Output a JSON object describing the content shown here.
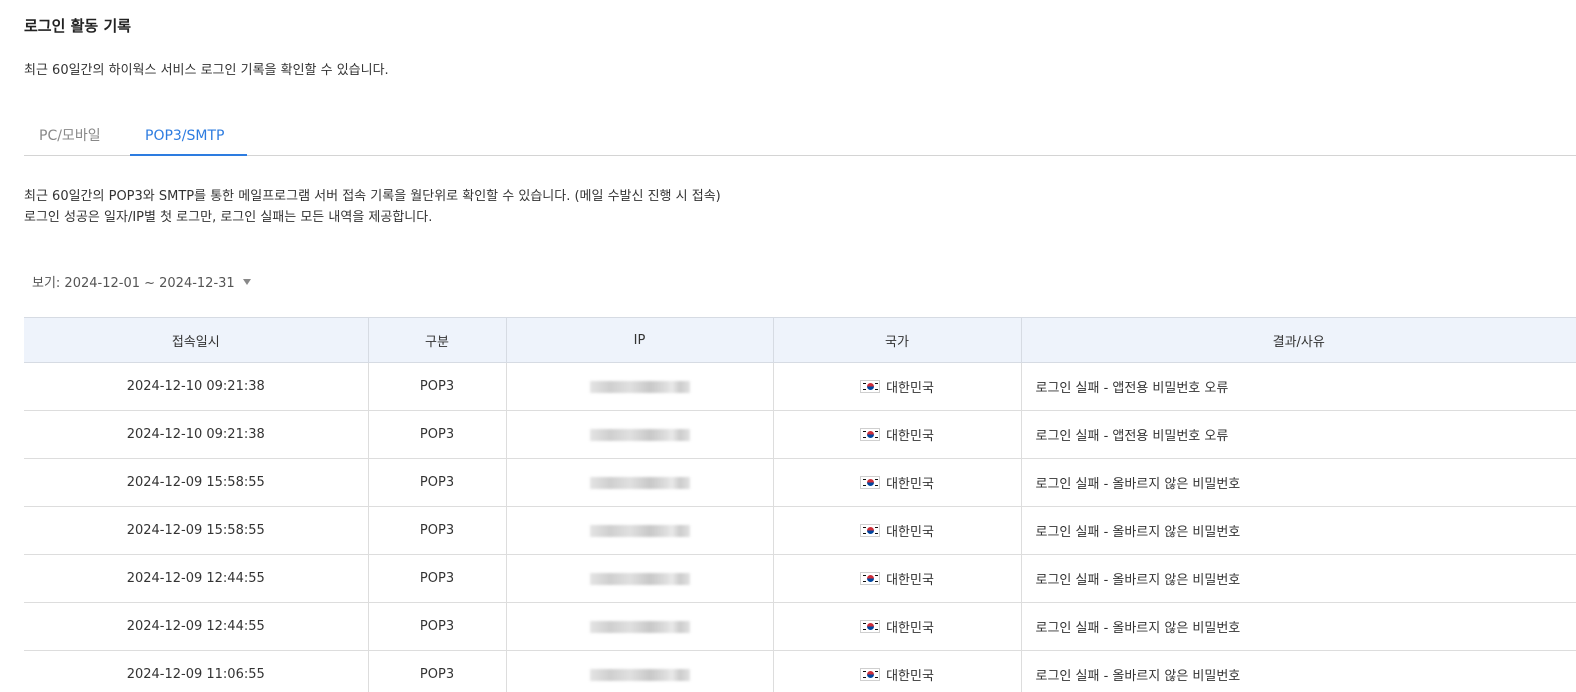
{
  "page": {
    "title": "로그인 활동 기록",
    "description": "최근 60일간의 하이웍스 서비스 로그인 기록을 확인할 수 있습니다."
  },
  "tabs": [
    {
      "label": "PC/모바일",
      "active": false
    },
    {
      "label": "POP3/SMTP",
      "active": true
    }
  ],
  "notice": {
    "line1": "최근 60일간의 POP3와 SMTP를 통한 메일프로그램 서버 접속 기록을 월단위로 확인할 수 있습니다. (메일 수발신 진행 시 접속)",
    "line2": "로그인 성공은 일자/IP별 첫 로그만, 로그인 실패는 모든 내역을 제공합니다."
  },
  "filter": {
    "label": "보기: 2024-12-01 ~ 2024-12-31"
  },
  "table": {
    "headers": {
      "datetime": "접속일시",
      "type": "구분",
      "ip": "IP",
      "country": "국가",
      "result": "결과/사유"
    },
    "rows": [
      {
        "datetime": "2024-12-10 09:21:38",
        "type": "POP3",
        "country": "대한민국",
        "result": "로그인 실패 - 앱전용 비밀번호 오류"
      },
      {
        "datetime": "2024-12-10 09:21:38",
        "type": "POP3",
        "country": "대한민국",
        "result": "로그인 실패 - 앱전용 비밀번호 오류"
      },
      {
        "datetime": "2024-12-09 15:58:55",
        "type": "POP3",
        "country": "대한민국",
        "result": "로그인 실패 - 올바르지 않은 비밀번호"
      },
      {
        "datetime": "2024-12-09 15:58:55",
        "type": "POP3",
        "country": "대한민국",
        "result": "로그인 실패 - 올바르지 않은 비밀번호"
      },
      {
        "datetime": "2024-12-09 12:44:55",
        "type": "POP3",
        "country": "대한민국",
        "result": "로그인 실패 - 올바르지 않은 비밀번호"
      },
      {
        "datetime": "2024-12-09 12:44:55",
        "type": "POP3",
        "country": "대한민국",
        "result": "로그인 실패 - 올바르지 않은 비밀번호"
      },
      {
        "datetime": "2024-12-09 11:06:55",
        "type": "POP3",
        "country": "대한민국",
        "result": "로그인 실패 - 올바르지 않은 비밀번호"
      }
    ]
  },
  "colors": {
    "accent": "#2d7ce0",
    "header_bg": "#eef3fb"
  },
  "icons": {
    "flag": "south-korea-flag-icon",
    "filter_caret": "caret-down-icon"
  }
}
